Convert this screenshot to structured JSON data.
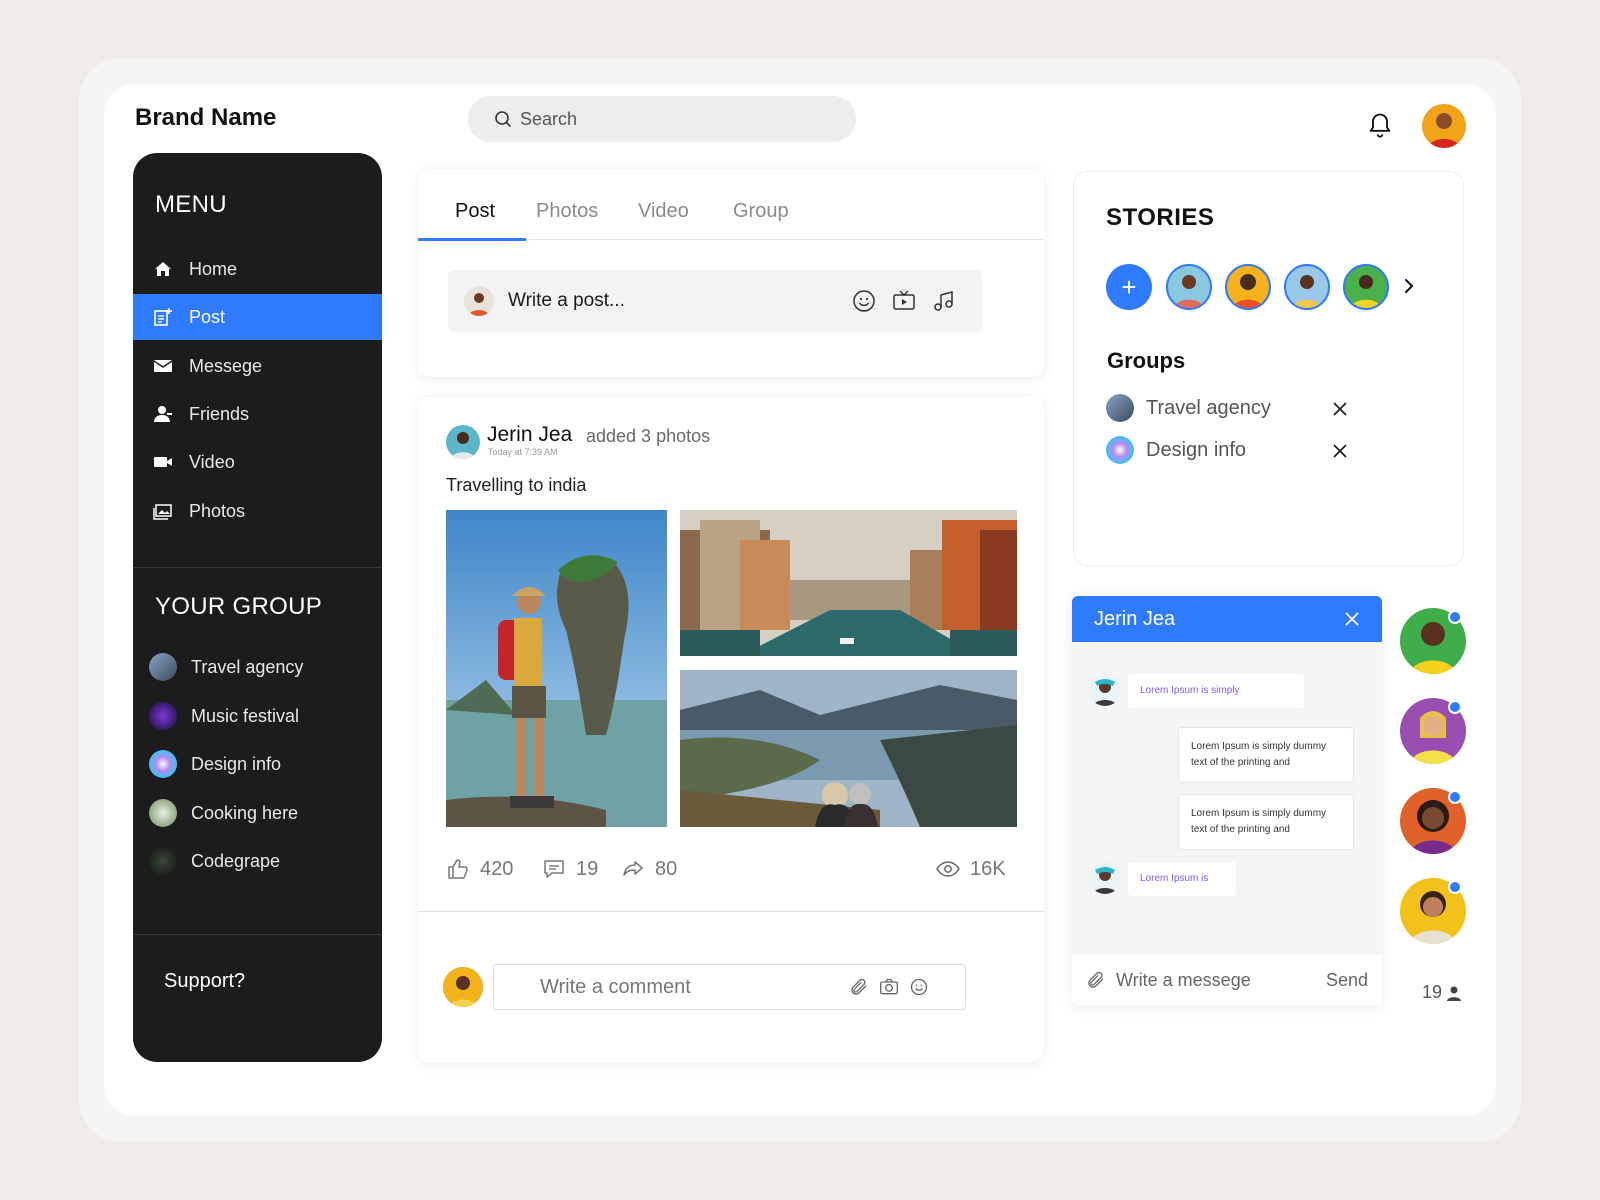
{
  "app": {
    "brand": "Brand Name"
  },
  "search": {
    "placeholder": "Search"
  },
  "sidebar": {
    "menu_title": "MENU",
    "items": [
      {
        "label": "Home",
        "icon": "home-icon"
      },
      {
        "label": "Post",
        "icon": "post-icon",
        "active": true
      },
      {
        "label": "Messege",
        "icon": "mail-icon"
      },
      {
        "label": "Friends",
        "icon": "friends-icon"
      },
      {
        "label": "Video",
        "icon": "video-icon"
      },
      {
        "label": "Photos",
        "icon": "photos-icon"
      }
    ],
    "group_title": "YOUR GROUP",
    "groups": [
      {
        "label": "Travel agency"
      },
      {
        "label": "Music festival"
      },
      {
        "label": "Design info"
      },
      {
        "label": "Cooking here"
      },
      {
        "label": "Codegrape"
      }
    ],
    "support": "Support?"
  },
  "composer": {
    "tabs": [
      "Post",
      "Photos",
      "Video",
      "Group"
    ],
    "active_tab": "Post",
    "placeholder": "Write a post..."
  },
  "post": {
    "author": "Jerin Jea",
    "action": "added 3 photos",
    "time": "Today at 7:39 AM",
    "caption": "Travelling to india",
    "likes": "420",
    "comments": "19",
    "shares": "80",
    "views": "16K",
    "comment_placeholder": "Write a comment"
  },
  "stories": {
    "title": "STORIES",
    "add_label": "+"
  },
  "groups_panel": {
    "title": "Groups",
    "items": [
      {
        "label": "Travel agency"
      },
      {
        "label": "Design info"
      }
    ]
  },
  "chat": {
    "name": "Jerin Jea",
    "messages": [
      {
        "from": "them",
        "text": "Lorem Ipsum is simply"
      },
      {
        "from": "me",
        "text": "Lorem Ipsum is simply dummy text of the printing and"
      },
      {
        "from": "me",
        "text": "Lorem Ipsum is simply dummy text of the printing and"
      },
      {
        "from": "them",
        "text": "Lorem Ipsum is"
      }
    ],
    "input_placeholder": "Write a messege",
    "send_label": "Send"
  },
  "online": {
    "count": "19"
  },
  "colors": {
    "accent": "#2f7bff",
    "sidebar_bg": "#1c1c1c"
  }
}
